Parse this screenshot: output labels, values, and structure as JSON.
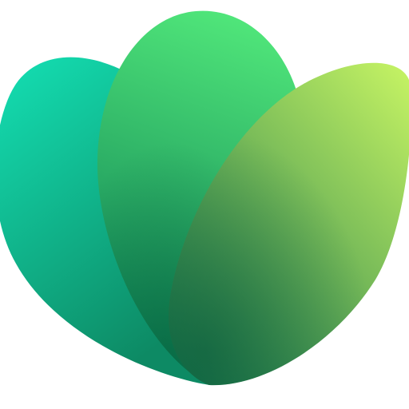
{
  "icon": {
    "name": "three-petal-leaf-logo",
    "colors": {
      "background": "#ffffff",
      "left_petal_top": "#14e0b4",
      "left_petal_bottom": "#0d8a64",
      "middle_petal_top": "#50e67a",
      "middle_petal_bottom": "#0a7a52",
      "right_petal_top": "#c8f564",
      "right_petal_bottom": "#1f7a4c"
    }
  }
}
